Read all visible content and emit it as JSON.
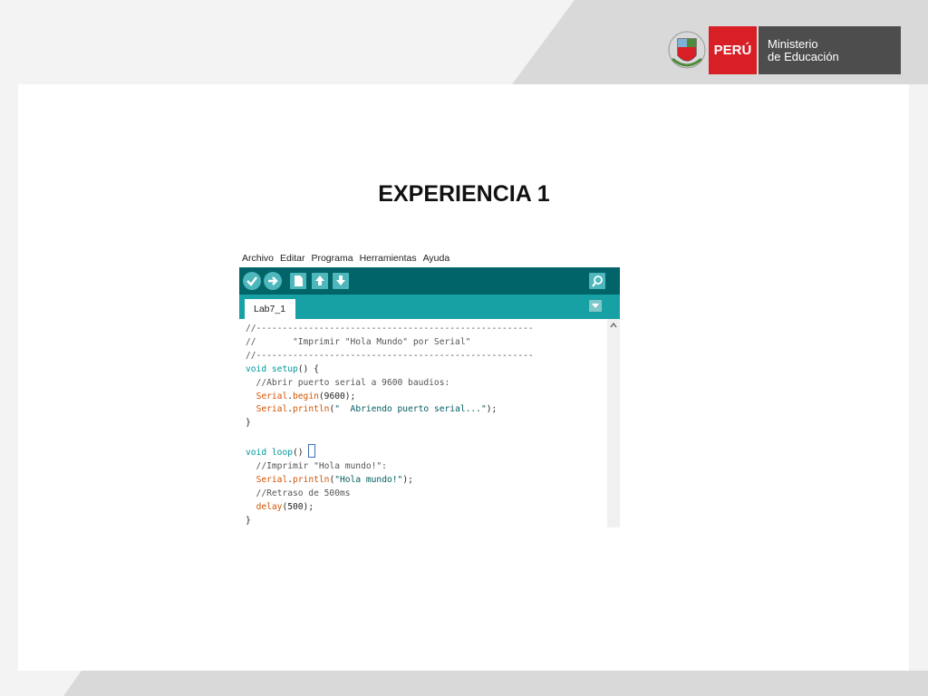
{
  "slide": {
    "title": "EXPERIENCIA 1"
  },
  "logo": {
    "country": "PERÚ",
    "ministry_line1": "Ministerio",
    "ministry_line2": "de Educación"
  },
  "ide": {
    "menu": [
      "Archivo",
      "Editar",
      "Programa",
      "Herramientas",
      "Ayuda"
    ],
    "toolbar_icons": [
      "verify-icon",
      "upload-icon",
      "new-icon",
      "open-icon",
      "save-icon",
      "serial-monitor-icon"
    ],
    "tab_label": "Lab7_1",
    "code": {
      "l1": "//-----------------------------------------------------",
      "l2": "//       \"Imprimir \"Hola Mundo\" por Serial\"",
      "l3": "//-----------------------------------------------------",
      "l4_kw": "void",
      "l4_fn": "setup",
      "l4_rest": "() {",
      "l5": "  //Abrir puerto serial a 9600 baudios:",
      "l6_obj": "Serial",
      "l6_fn": "begin",
      "l6_rest": "(9600);",
      "l7_obj": "Serial",
      "l7_fn": "println",
      "l7_str": "\"  Abriendo puerto serial...\"",
      "l7_end": ");",
      "l8": "}",
      "l10_kw": "void",
      "l10_fn": "loop",
      "l10_rest": "() ",
      "l11": "  //Imprimir \"Hola mundo!\":",
      "l12_obj": "Serial",
      "l12_fn": "println",
      "l12_str": "\"Hola mundo!\"",
      "l12_end": ");",
      "l13": "  //Retraso de 500ms",
      "l14_fn": "delay",
      "l14_rest": "(500);",
      "l15": "}"
    }
  }
}
